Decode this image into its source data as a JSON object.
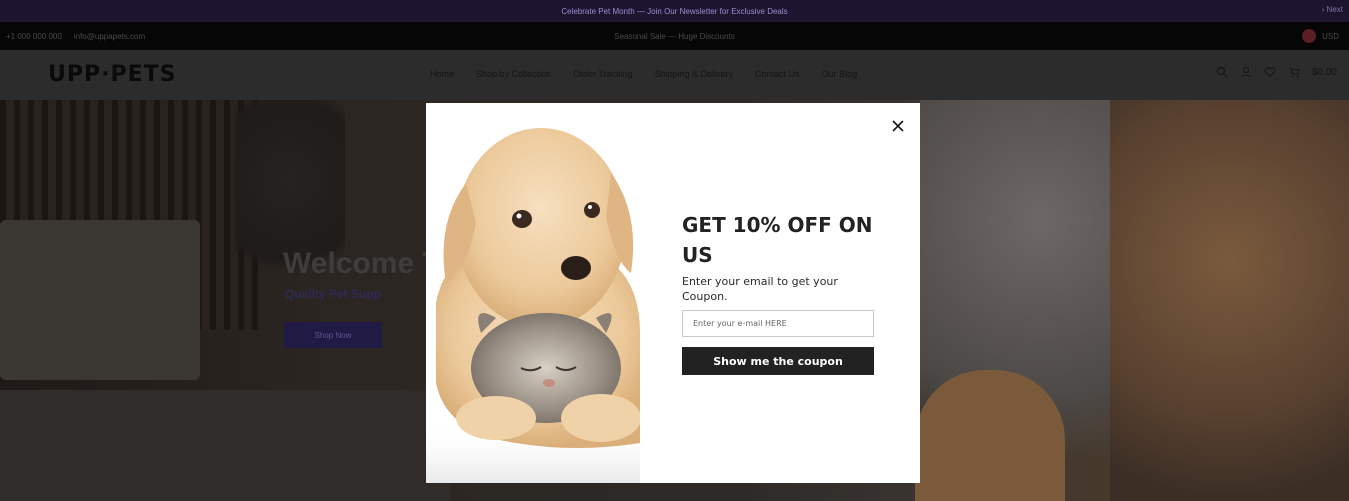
{
  "announcement": {
    "text": "Celebrate Pet Month — Join Our Newsletter for Exclusive Deals",
    "next_label": "› Next"
  },
  "topbar": {
    "phone": "+1 000 000 000",
    "email": "info@uppapets.com",
    "center_text": "Seasonal Sale — Huge Discounts",
    "language": "USD"
  },
  "header": {
    "logo_text": "UPP·PETS",
    "nav": [
      "Home",
      "Shop by Collection",
      "Order Tracking",
      "Shipping & Delivery",
      "Contact Us",
      "Our Blog"
    ],
    "cart_label": "$0.00"
  },
  "hero": {
    "title": "Welcome T",
    "subtitle": "Quality Pet Supp",
    "button_label": "Shop Now"
  },
  "popup": {
    "heading": "GET 10% OFF ON US",
    "description": "Enter your email to get your Coupon.",
    "email_placeholder": "Enter your e-mail HERE",
    "email_value": "",
    "cta_label": "Show me the coupon",
    "close_icon": "close-icon"
  },
  "colors": {
    "popup_bg": "#ffffff",
    "cta_bg": "#222222",
    "announce_bg": "#1c1530"
  }
}
